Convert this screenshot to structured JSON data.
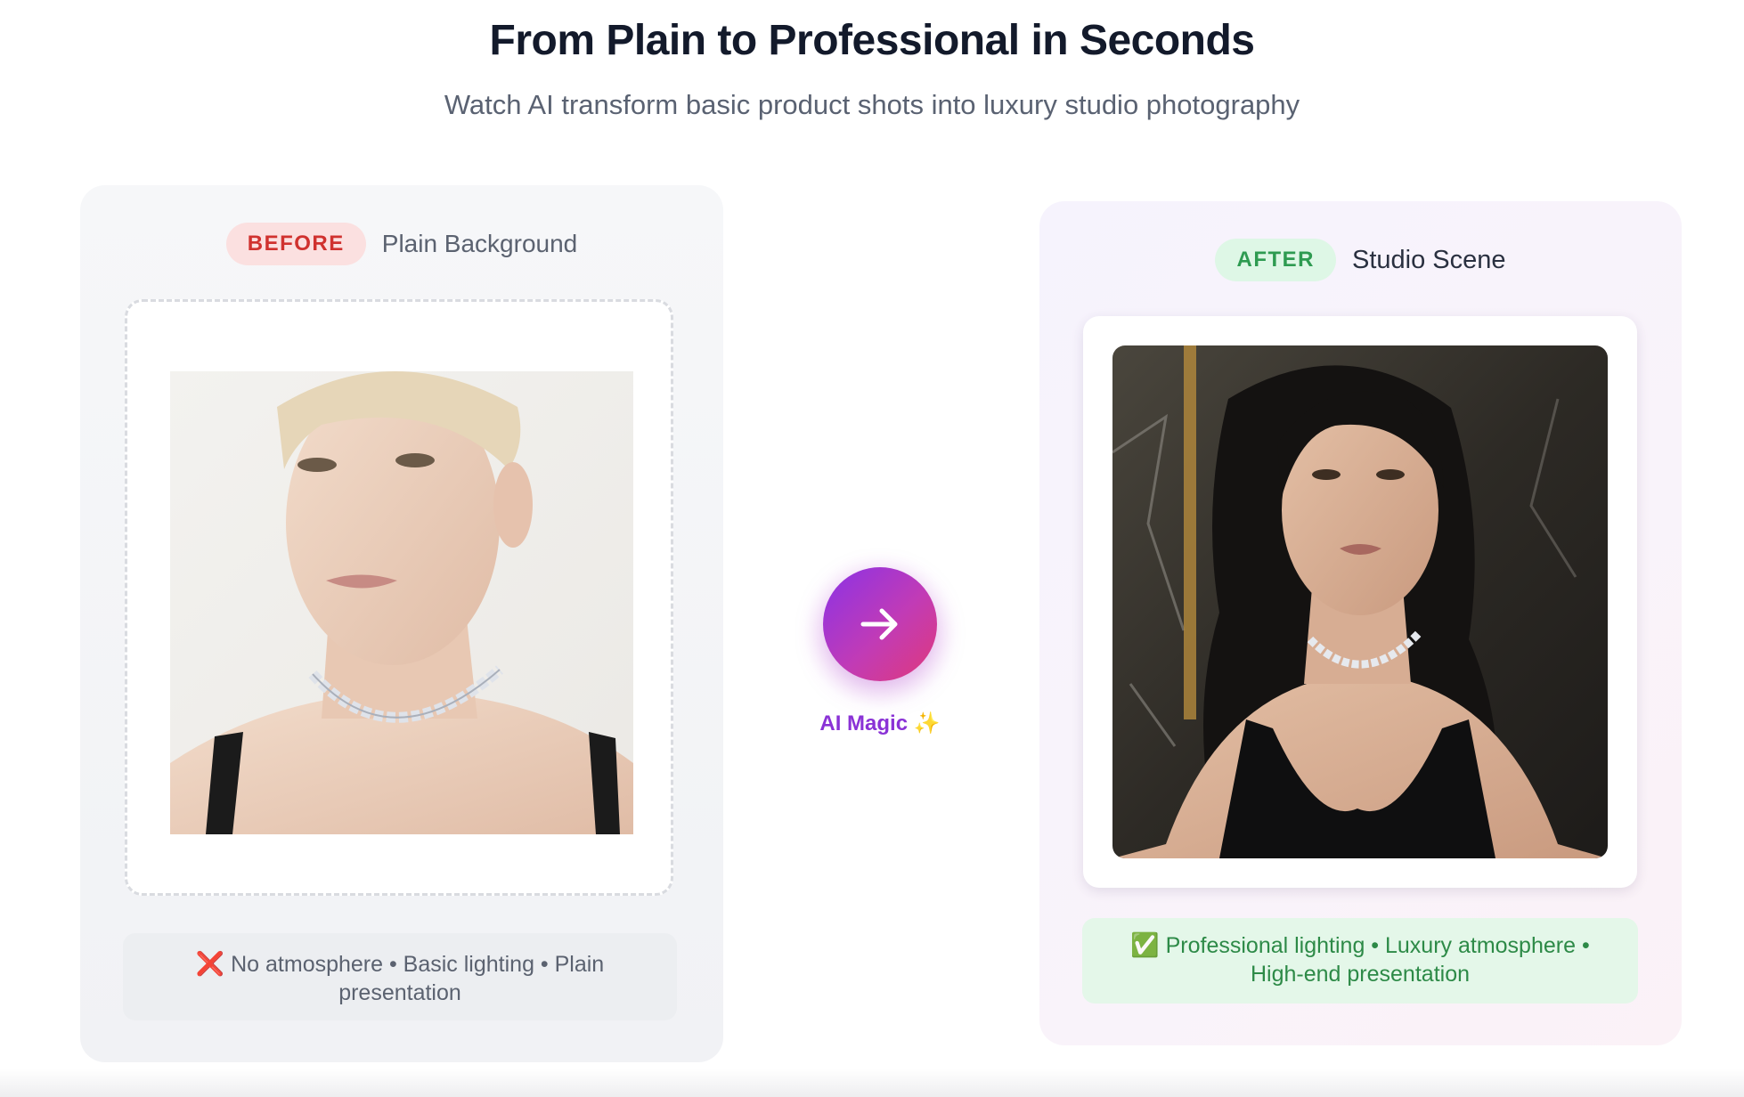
{
  "header": {
    "title": "From Plain to Professional in Seconds",
    "subtitle": "Watch AI transform basic product shots into luxury studio photography"
  },
  "before": {
    "badge": "BEFORE",
    "label": "Plain Background",
    "caption_icon": "cross-mark-icon",
    "caption_icon_glyph": "❌",
    "caption": "No atmosphere • Basic lighting • Plain presentation"
  },
  "after": {
    "badge": "AFTER",
    "label": "Studio Scene",
    "caption_icon": "check-mark-icon",
    "caption_icon_glyph": "✅",
    "caption": "Professional lighting • Luxury atmosphere • High-end presentation"
  },
  "transition": {
    "label": "AI Magic",
    "sparkle": "✨",
    "icon": "arrow-right-icon"
  },
  "colors": {
    "before_accent": "#d0322f",
    "after_accent": "#2e9b51",
    "magic_gradient_start": "#8a32e6",
    "magic_gradient_end": "#e03a7a"
  }
}
